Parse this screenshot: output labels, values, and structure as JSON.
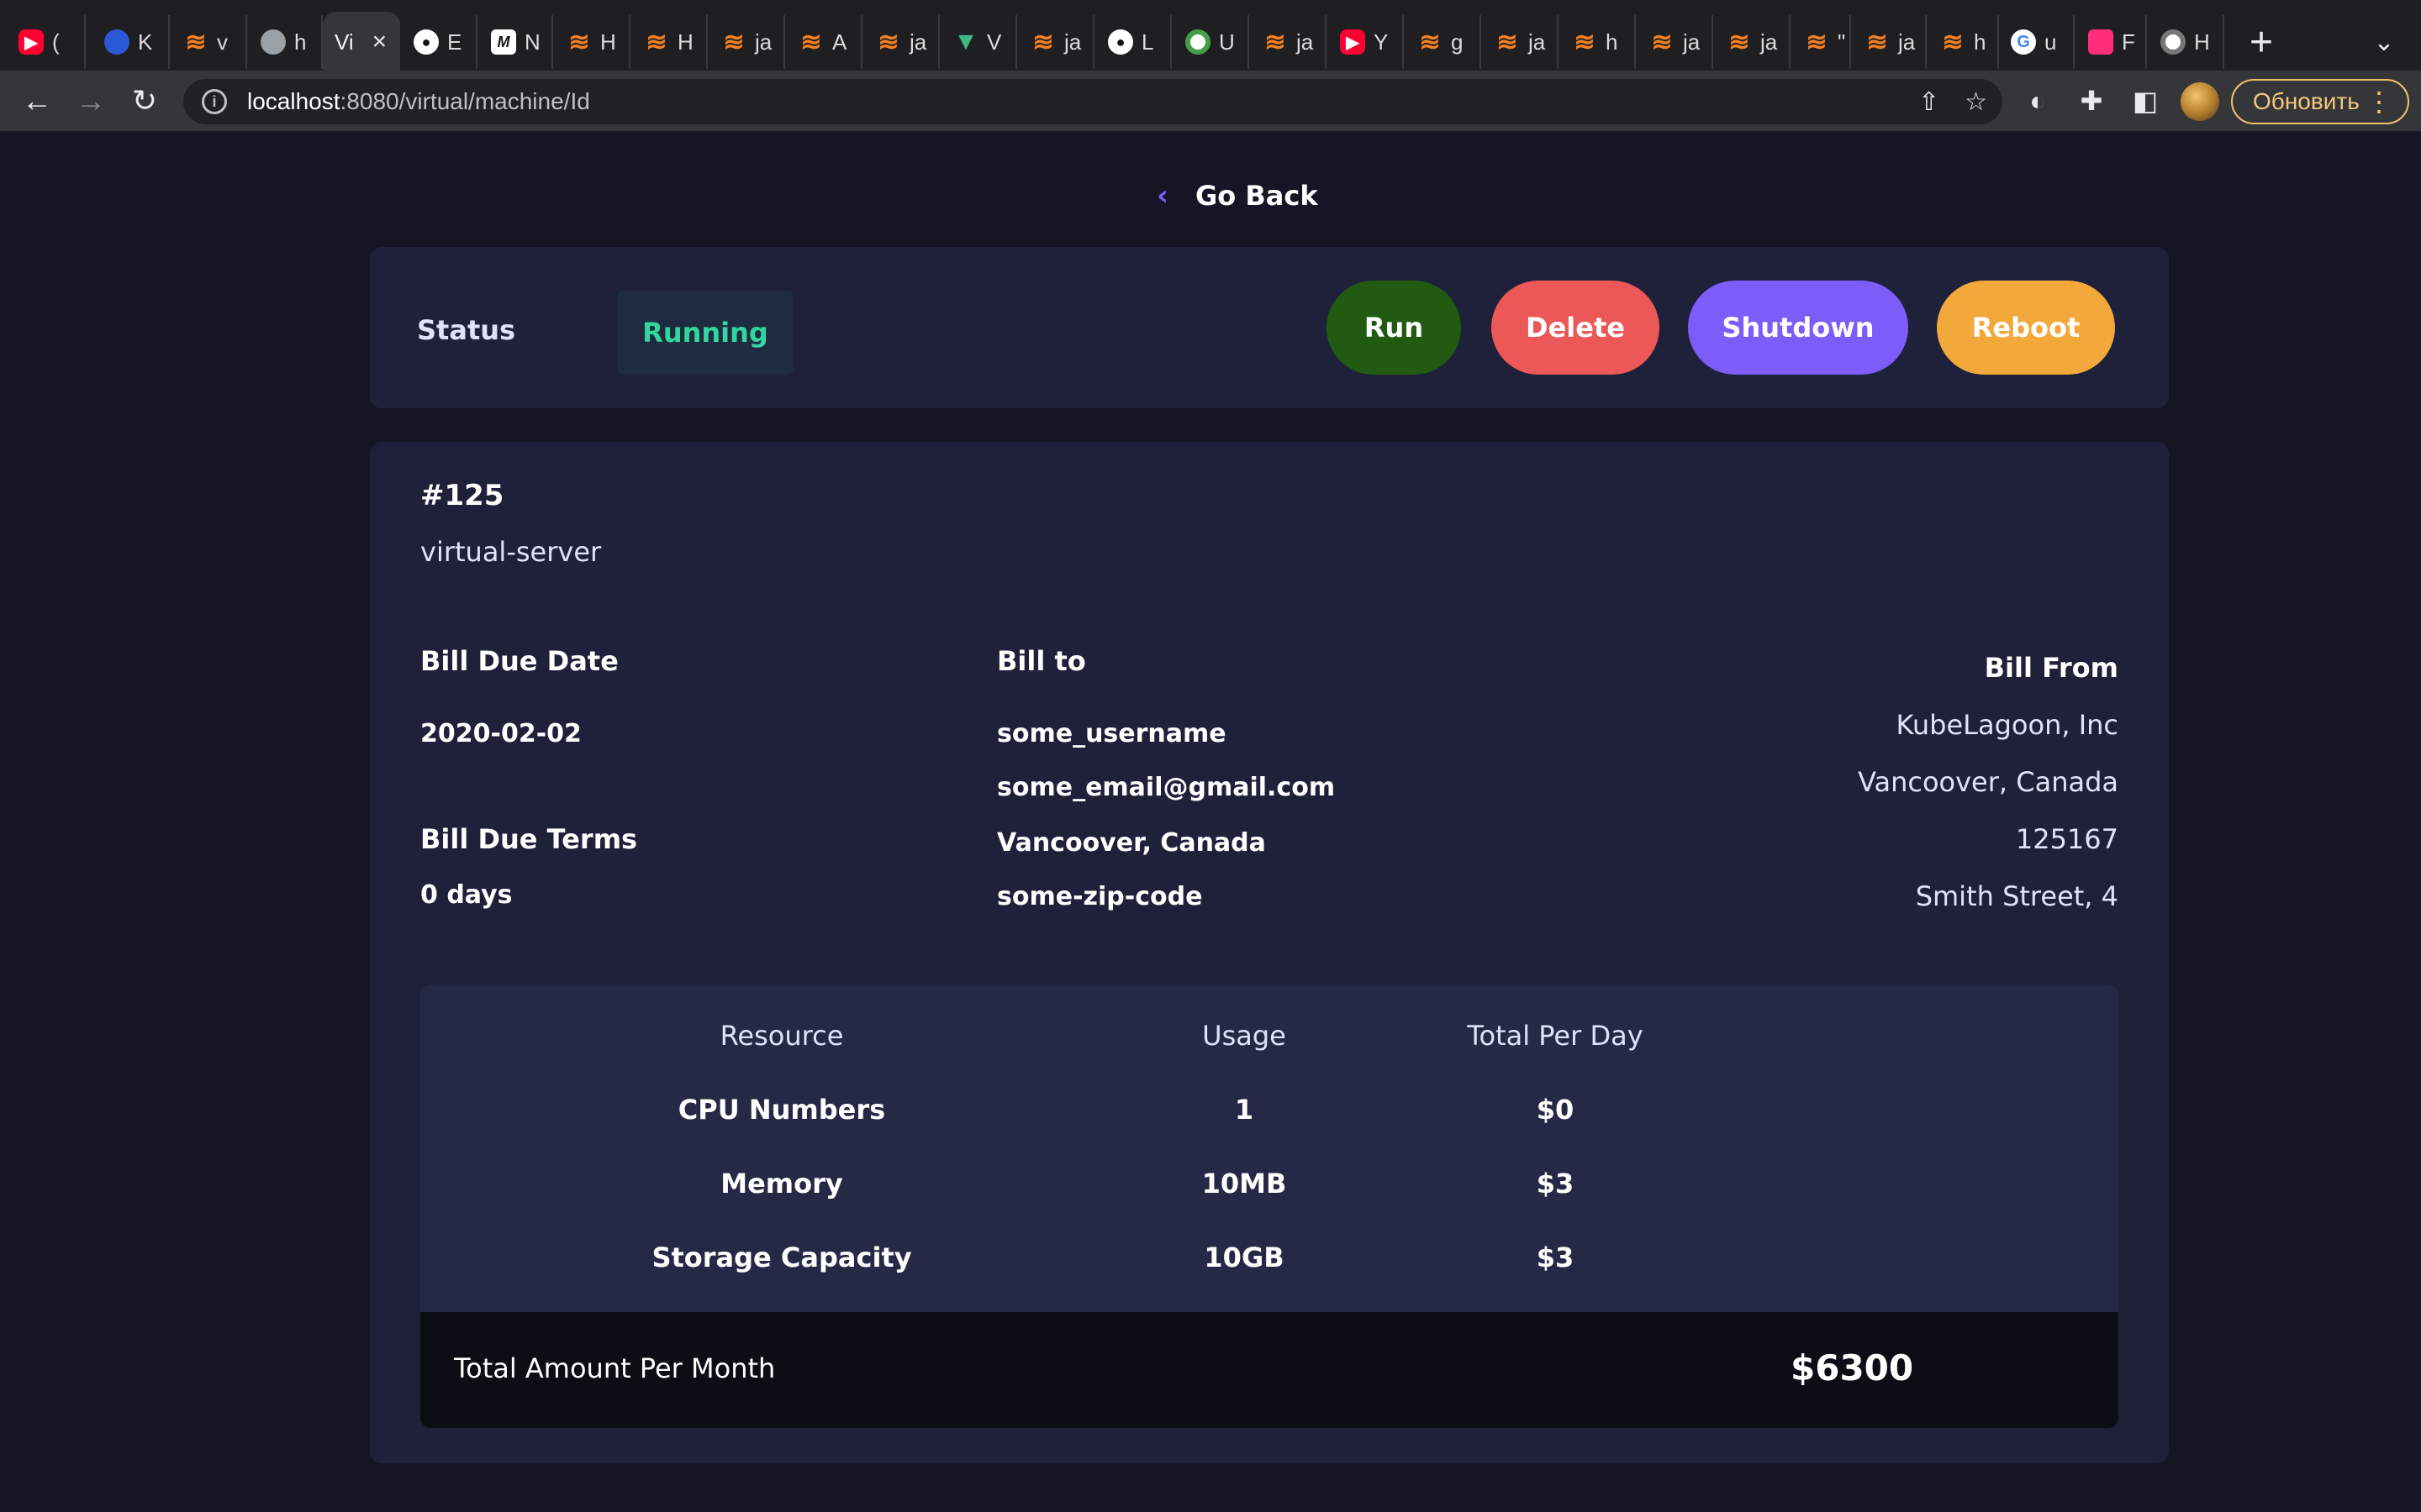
{
  "browser": {
    "tabs": [
      {
        "icon": "youtube-icon",
        "text": "("
      },
      {
        "icon": "phone-icon",
        "text": "K"
      },
      {
        "icon": "stackoverflow-icon",
        "text": "v"
      },
      {
        "icon": "globe-icon",
        "text": "h"
      },
      {
        "icon": "none",
        "text": "Vi",
        "active": true
      },
      {
        "icon": "github-icon",
        "text": "E"
      },
      {
        "icon": "m-logo-icon",
        "text": "N"
      },
      {
        "icon": "stackoverflow-icon",
        "text": "H"
      },
      {
        "icon": "stackoverflow-icon",
        "text": "H"
      },
      {
        "icon": "stackoverflow-icon",
        "text": "ja"
      },
      {
        "icon": "stackoverflow-icon",
        "text": "A"
      },
      {
        "icon": "stackoverflow-icon",
        "text": "ja"
      },
      {
        "icon": "vue-icon",
        "text": "V"
      },
      {
        "icon": "stackoverflow-icon",
        "text": "ja"
      },
      {
        "icon": "github-icon",
        "text": "L"
      },
      {
        "icon": "clock-icon",
        "text": "U"
      },
      {
        "icon": "stackoverflow-icon",
        "text": "ja"
      },
      {
        "icon": "youtube-icon",
        "text": "Y"
      },
      {
        "icon": "stackoverflow-icon",
        "text": "g"
      },
      {
        "icon": "stackoverflow-icon",
        "text": "ja"
      },
      {
        "icon": "stackoverflow-icon",
        "text": "h"
      },
      {
        "icon": "stackoverflow-icon",
        "text": "ja"
      },
      {
        "icon": "stackoverflow-icon",
        "text": "ja"
      },
      {
        "icon": "stackoverflow-icon",
        "text": "\""
      },
      {
        "icon": "stackoverflow-icon",
        "text": "ja"
      },
      {
        "icon": "stackoverflow-icon",
        "text": "h"
      },
      {
        "icon": "google-icon",
        "text": "u"
      },
      {
        "icon": "pink-app-icon",
        "text": "F"
      },
      {
        "icon": "chrome-icon",
        "text": "H"
      }
    ],
    "url_host": "localhost",
    "url_path": ":8080/virtual/machine/Id",
    "update_label": "Обновить"
  },
  "page": {
    "go_back_label": "Go Back",
    "status_label": "Status",
    "status_value": "Running",
    "actions": {
      "run": "Run",
      "delete": "Delete",
      "shutdown": "Shutdown",
      "reboot": "Reboot"
    },
    "vm": {
      "id": "#125",
      "name": "virtual-server"
    },
    "bill_due_date_label": "Bill Due Date",
    "bill_due_date": "2020-02-02",
    "bill_due_terms_label": "Bill Due Terms",
    "bill_due_terms": "0 days",
    "bill_to_label": "Bill to",
    "bill_to": {
      "username": "some_username",
      "email": "some_email@gmail.com",
      "location": "Vancoover, Canada",
      "zip": "some-zip-code"
    },
    "bill_from_label": "Bill From",
    "bill_from": {
      "company": "KubeLagoon, Inc",
      "location": "Vancoover, Canada",
      "code": "125167",
      "street": "Smith Street, 4"
    },
    "table": {
      "headers": [
        "Resource",
        "Usage",
        "Total Per Day"
      ],
      "rows": [
        [
          "CPU Numbers",
          "1",
          "$0"
        ],
        [
          "Memory",
          "10MB",
          "$3"
        ],
        [
          "Storage Capacity",
          "10GB",
          "$3"
        ]
      ],
      "total_label": "Total Amount Per Month",
      "total_value": "$6300"
    }
  },
  "colors": {
    "background": "#141625",
    "card": "#1e2139",
    "table": "#252945",
    "accent": "#7c5dfa",
    "running": "#33d69f",
    "run_button": "#215b12",
    "delete_button": "#ec5757",
    "reboot_button": "#f2a83b"
  }
}
